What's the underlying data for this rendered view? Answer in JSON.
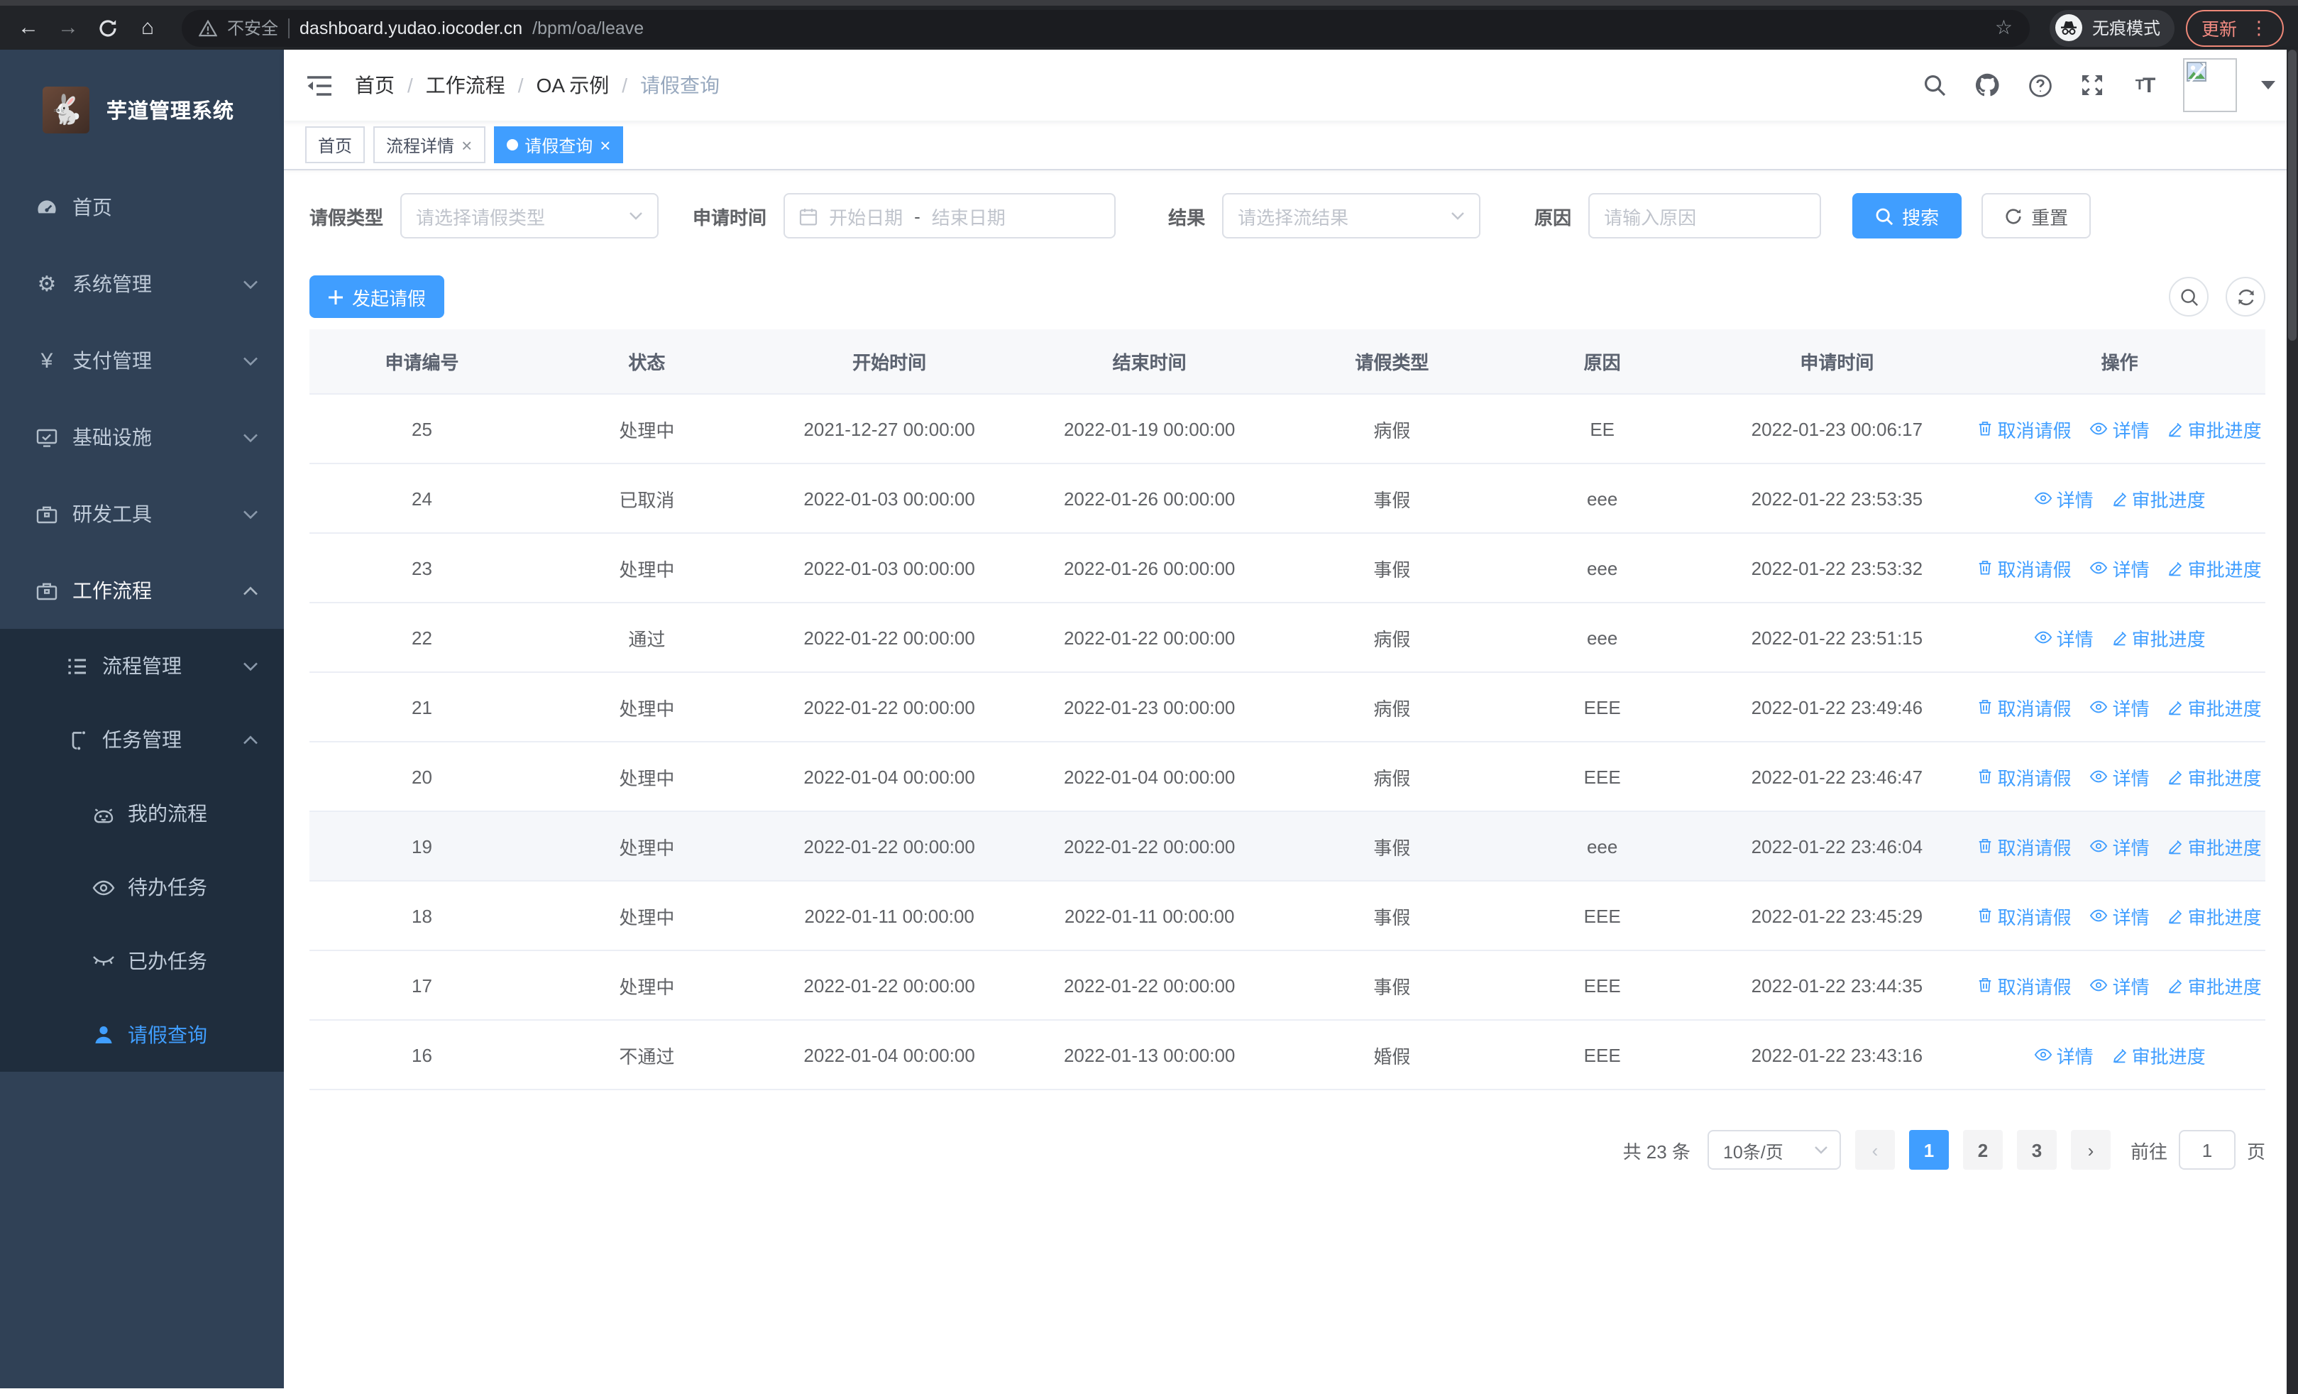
{
  "browser": {
    "security_warning": "不安全",
    "url_host": "dashboard.yudao.iocoder.cn",
    "url_path": "/bpm/oa/leave",
    "incognito_label": "无痕模式",
    "update_label": "更新"
  },
  "sidebar": {
    "title": "芋道管理系统",
    "menu": [
      {
        "label": "首页"
      },
      {
        "label": "系统管理"
      },
      {
        "label": "支付管理"
      },
      {
        "label": "基础设施"
      },
      {
        "label": "研发工具"
      },
      {
        "label": "工作流程"
      }
    ],
    "submenu": [
      {
        "label": "流程管理"
      },
      {
        "label": "任务管理"
      }
    ],
    "task_children": [
      {
        "label": "我的流程"
      },
      {
        "label": "待办任务"
      },
      {
        "label": "已办任务"
      },
      {
        "label": "请假查询"
      }
    ]
  },
  "header": {
    "breadcrumb": [
      "首页",
      "工作流程",
      "OA 示例",
      "请假查询"
    ]
  },
  "tabs": [
    {
      "label": "首页"
    },
    {
      "label": "流程详情"
    },
    {
      "label": "请假查询"
    }
  ],
  "filters": {
    "leave_type_label": "请假类型",
    "leave_type_placeholder": "请选择请假类型",
    "apply_time_label": "申请时间",
    "date_start_placeholder": "开始日期",
    "date_separator": "-",
    "date_end_placeholder": "结束日期",
    "result_label": "结果",
    "result_placeholder": "请选择流结果",
    "reason_label": "原因",
    "reason_placeholder": "请输入原因",
    "search_label": "搜索",
    "reset_label": "重置"
  },
  "toolbar": {
    "create_label": "发起请假"
  },
  "table": {
    "columns": [
      "申请编号",
      "状态",
      "开始时间",
      "结束时间",
      "请假类型",
      "原因",
      "申请时间",
      "操作"
    ],
    "action_labels": {
      "cancel": "取消请假",
      "detail": "详情",
      "progress": "审批进度"
    },
    "rows": [
      {
        "id": "25",
        "status": "处理中",
        "start": "2021-12-27 00:00:00",
        "end": "2022-01-19 00:00:00",
        "type": "病假",
        "reason": "EE",
        "apply_time": "2022-01-23 00:06:17",
        "cancellable": true,
        "highlight": false
      },
      {
        "id": "24",
        "status": "已取消",
        "start": "2022-01-03 00:00:00",
        "end": "2022-01-26 00:00:00",
        "type": "事假",
        "reason": "eee",
        "apply_time": "2022-01-22 23:53:35",
        "cancellable": false,
        "highlight": false
      },
      {
        "id": "23",
        "status": "处理中",
        "start": "2022-01-03 00:00:00",
        "end": "2022-01-26 00:00:00",
        "type": "事假",
        "reason": "eee",
        "apply_time": "2022-01-22 23:53:32",
        "cancellable": true,
        "highlight": false
      },
      {
        "id": "22",
        "status": "通过",
        "start": "2022-01-22 00:00:00",
        "end": "2022-01-22 00:00:00",
        "type": "病假",
        "reason": "eee",
        "apply_time": "2022-01-22 23:51:15",
        "cancellable": false,
        "highlight": false
      },
      {
        "id": "21",
        "status": "处理中",
        "start": "2022-01-22 00:00:00",
        "end": "2022-01-23 00:00:00",
        "type": "病假",
        "reason": "EEE",
        "apply_time": "2022-01-22 23:49:46",
        "cancellable": true,
        "highlight": false
      },
      {
        "id": "20",
        "status": "处理中",
        "start": "2022-01-04 00:00:00",
        "end": "2022-01-04 00:00:00",
        "type": "病假",
        "reason": "EEE",
        "apply_time": "2022-01-22 23:46:47",
        "cancellable": true,
        "highlight": false
      },
      {
        "id": "19",
        "status": "处理中",
        "start": "2022-01-22 00:00:00",
        "end": "2022-01-22 00:00:00",
        "type": "事假",
        "reason": "eee",
        "apply_time": "2022-01-22 23:46:04",
        "cancellable": true,
        "highlight": true
      },
      {
        "id": "18",
        "status": "处理中",
        "start": "2022-01-11 00:00:00",
        "end": "2022-01-11 00:00:00",
        "type": "事假",
        "reason": "EEE",
        "apply_time": "2022-01-22 23:45:29",
        "cancellable": true,
        "highlight": false
      },
      {
        "id": "17",
        "status": "处理中",
        "start": "2022-01-22 00:00:00",
        "end": "2022-01-22 00:00:00",
        "type": "事假",
        "reason": "EEE",
        "apply_time": "2022-01-22 23:44:35",
        "cancellable": true,
        "highlight": false
      },
      {
        "id": "16",
        "status": "不通过",
        "start": "2022-01-04 00:00:00",
        "end": "2022-01-13 00:00:00",
        "type": "婚假",
        "reason": "EEE",
        "apply_time": "2022-01-22 23:43:16",
        "cancellable": false,
        "highlight": false
      }
    ]
  },
  "pagination": {
    "total_label": "共 23 条",
    "page_size": "10条/页",
    "pages": [
      "1",
      "2",
      "3"
    ],
    "active_page": "1",
    "goto_label": "前往",
    "goto_value": "1",
    "page_unit": "页"
  },
  "colors": {
    "primary": "#409eff",
    "sidebar_bg": "#304156",
    "submenu_bg": "#1f2d3d",
    "chrome_bg": "#222428",
    "update_accent": "#f28b82",
    "table_header_bg": "#f7f8fa"
  }
}
